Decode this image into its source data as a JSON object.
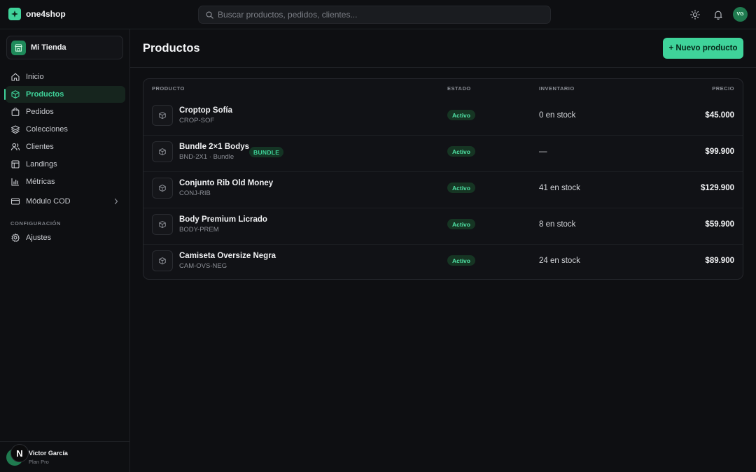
{
  "brand": {
    "name": "one4shop",
    "accent": "#3fd39a"
  },
  "search": {
    "placeholder": "Buscar productos, pedidos, clientes..."
  },
  "topbar": {
    "avatar_initials": "VG",
    "icons": [
      "sun-icon",
      "bell-icon"
    ]
  },
  "sidebar": {
    "store_name": "Mi Tienda",
    "items": [
      {
        "label": "Inicio",
        "icon": "home-icon",
        "active": false
      },
      {
        "label": "Productos",
        "icon": "box-icon",
        "active": true
      },
      {
        "label": "Pedidos",
        "icon": "bag-icon",
        "active": false
      },
      {
        "label": "Colecciones",
        "icon": "layers-icon",
        "active": false
      },
      {
        "label": "Clientes",
        "icon": "users-icon",
        "active": false
      },
      {
        "label": "Landings",
        "icon": "layout-icon",
        "active": false
      },
      {
        "label": "Métricas",
        "icon": "chart-icon",
        "active": false
      },
      {
        "label": "Módulo COD",
        "icon": "card-icon",
        "active": false
      }
    ],
    "section_label": "CONFIGURACIÓN",
    "settings_label": "Ajustes",
    "user": {
      "badge": "N",
      "name": "Victor García",
      "plan": "Plan Pro"
    }
  },
  "main": {
    "title": "Productos",
    "new_button": "+ Nuevo producto",
    "columns": {
      "product": "PRODUCTO",
      "status": "ESTADO",
      "inventory": "INVENTARIO",
      "price": "PRECIO"
    },
    "products": [
      {
        "name": "Croptop Sofía",
        "sku": "CROP-SOF",
        "badge": "",
        "status": "Activo",
        "inventory": "0 en stock",
        "price": "$45.000"
      },
      {
        "name": "Bundle 2×1 Bodys",
        "sku": "BND-2X1 · Bundle",
        "badge": "BUNDLE",
        "status": "Activo",
        "inventory": "—",
        "price": "$99.900"
      },
      {
        "name": "Conjunto Rib Old Money",
        "sku": "CONJ-RIB",
        "badge": "",
        "status": "Activo",
        "inventory": "41 en stock",
        "price": "$129.900"
      },
      {
        "name": "Body Premium Licrado",
        "sku": "BODY-PREM",
        "badge": "",
        "status": "Activo",
        "inventory": "8 en stock",
        "price": "$59.900"
      },
      {
        "name": "Camiseta Oversize Negra",
        "sku": "CAM-OVS-NEG",
        "badge": "",
        "status": "Activo",
        "inventory": "24 en stock",
        "price": "$89.900"
      }
    ]
  }
}
